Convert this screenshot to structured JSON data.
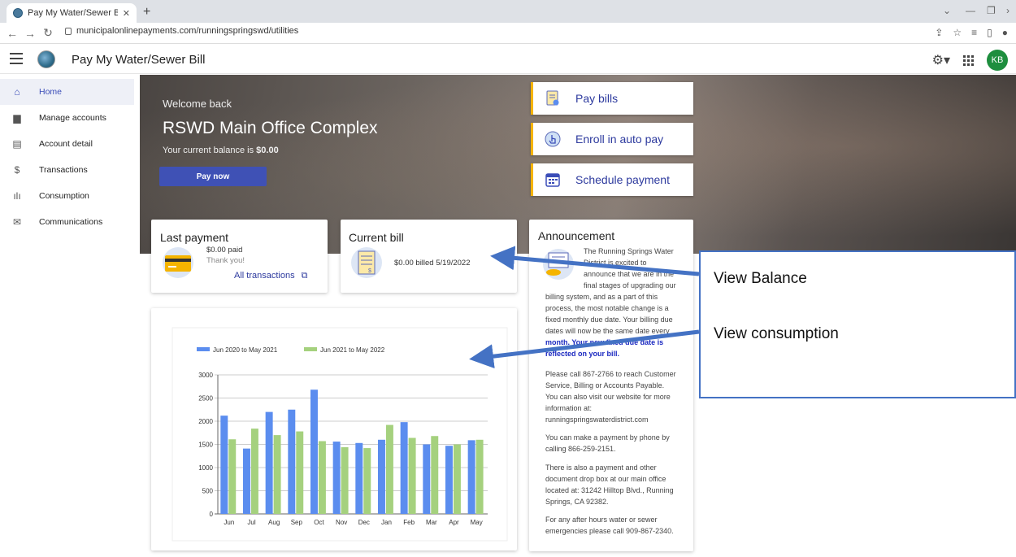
{
  "browser": {
    "tab_title": "Pay My Water/Sewer Bill Home - ",
    "new_tab": "+",
    "url": "municipalonlinepayments.com/runningspringswd/utilities"
  },
  "header": {
    "title": "Pay My Water/Sewer Bill",
    "avatar": "KB"
  },
  "sidebar": {
    "items": [
      {
        "label": "Home",
        "icon": "home-icon"
      },
      {
        "label": "Manage accounts",
        "icon": "folder-gear-icon"
      },
      {
        "label": "Account detail",
        "icon": "document-icon"
      },
      {
        "label": "Transactions",
        "icon": "dollar-icon"
      },
      {
        "label": "Consumption",
        "icon": "bar-chart-icon"
      },
      {
        "label": "Communications",
        "icon": "mail-icon"
      }
    ]
  },
  "hero": {
    "welcome": "Welcome back",
    "account_name": "RSWD Main Office Complex",
    "balance_prefix": "Your current balance is ",
    "balance_value": "$0.00",
    "pay_now": "Pay now",
    "actions": [
      "Pay bills",
      "Enroll in auto pay",
      "Schedule payment"
    ]
  },
  "last_payment": {
    "title": "Last payment",
    "amount": "$0.00 paid",
    "note": "Thank you!",
    "link": "All transactions"
  },
  "current_bill": {
    "title": "Current bill",
    "text": "$0.00 billed 5/19/2022"
  },
  "announcement": {
    "title": "Announcement",
    "para1_lines": [
      "The Running Springs Water",
      "District is excited to",
      "announce that we are in the",
      "final stages of upgrading our"
    ],
    "para1_rest": [
      "billing system, and as a part of this",
      "process, the most notable change is a",
      "fixed monthly due date. Your billing due",
      "dates will now be the same date every"
    ],
    "para1_bold": [
      "month. Your new fixed due date is",
      "reflected on your bill."
    ],
    "para2": [
      "Please call 867-2766 to reach Customer",
      "Service, Billing or Accounts Payable.",
      "You can also visit our website for more",
      "information at:",
      "runningspringswaterdistrict.com"
    ],
    "para3": [
      "You can make a payment by phone by",
      "calling 866-259-2151."
    ],
    "para4": [
      "There is also a payment and other",
      "document drop box at our main office",
      "located at: 31242 Hilltop Blvd., Running",
      "Springs, CA 92382."
    ],
    "para5": [
      "For any after hours water or sewer",
      "emergencies please call 909-867-2340."
    ]
  },
  "callout": {
    "line1": "View Balance",
    "line2": "View consumption"
  },
  "colors": {
    "series1": "#5b8def",
    "series2": "#a5d17e",
    "accent": "#3f51b5",
    "yellow": "#f5b400",
    "arrow": "#4472c4"
  },
  "chart_data": {
    "type": "bar",
    "categories": [
      "Jun",
      "Jul",
      "Aug",
      "Sep",
      "Oct",
      "Nov",
      "Dec",
      "Jan",
      "Feb",
      "Mar",
      "Apr",
      "May"
    ],
    "series": [
      {
        "name": "Jun 2020 to May 2021",
        "values": [
          2120,
          1410,
          2200,
          2250,
          2680,
          1560,
          1530,
          1600,
          1980,
          1500,
          1470,
          1590
        ]
      },
      {
        "name": "Jun 2021 to May 2022",
        "values": [
          1610,
          1840,
          1700,
          1780,
          1570,
          1440,
          1420,
          1920,
          1640,
          1680,
          1500,
          1600
        ]
      }
    ],
    "ylim": [
      0,
      3000
    ],
    "yticks": [
      0,
      500,
      1000,
      1500,
      2000,
      2500,
      3000
    ],
    "legend": "top-left"
  }
}
